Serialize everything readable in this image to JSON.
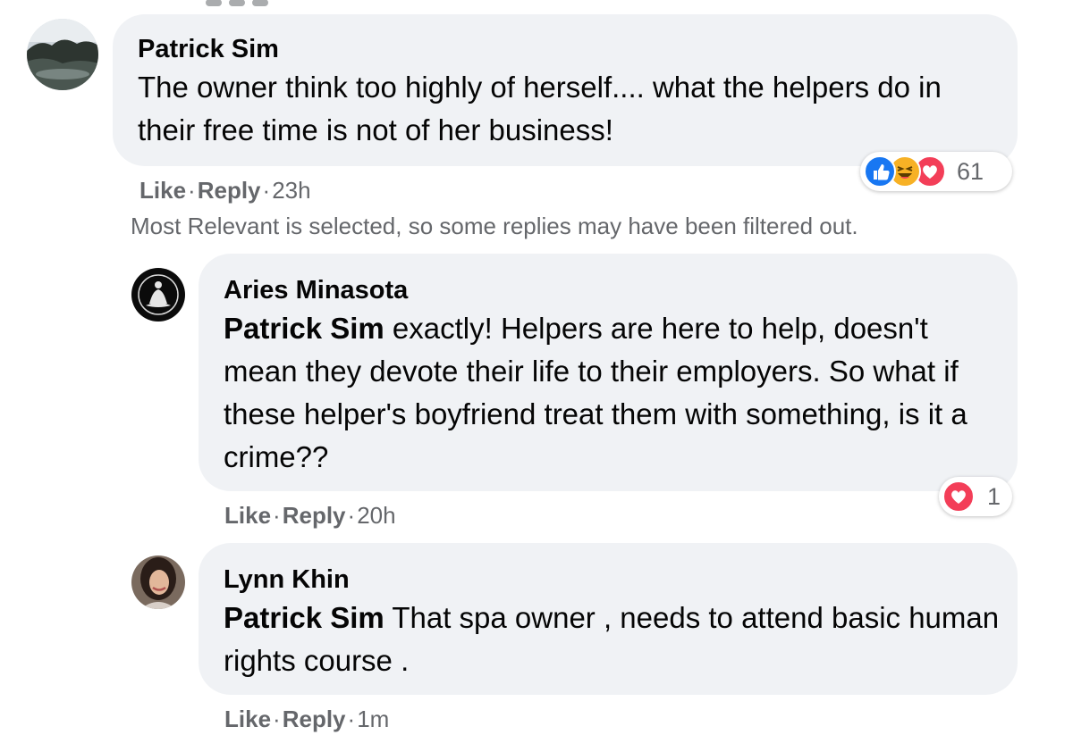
{
  "comments": [
    {
      "author": "Patrick Sim",
      "text": "The owner think too highly of herself.... what the helpers do in their free time is not of her business!",
      "mention": "",
      "like": "Like",
      "reply": "Reply",
      "time": "23h",
      "reaction_count": "61",
      "reaction_icons": [
        "like-icon",
        "haha-icon",
        "love-icon"
      ]
    },
    {
      "author": "Aries Minasota",
      "mention": "Patrick Sim",
      "text": " exactly! Helpers are here to help, doesn't mean they devote their life to their employers. So what if these helper's boyfriend treat them with something, is it a crime??",
      "like": "Like",
      "reply": "Reply",
      "time": "20h",
      "reaction_count": "1",
      "reaction_icons": [
        "love-icon"
      ]
    },
    {
      "author": "Lynn Khin",
      "mention": "Patrick Sim",
      "text": " That spa owner , needs to attend basic human rights course .",
      "like": "Like",
      "reply": "Reply",
      "time": "1m"
    }
  ],
  "notice": "Most Relevant is selected, so some replies may have been filtered out.",
  "colors": {
    "bubble": "#f0f2f5",
    "meta_text": "#65676b",
    "like_blue": "#1877f2",
    "love_red": "#f33e58",
    "haha_yellow": "#f7b125"
  }
}
